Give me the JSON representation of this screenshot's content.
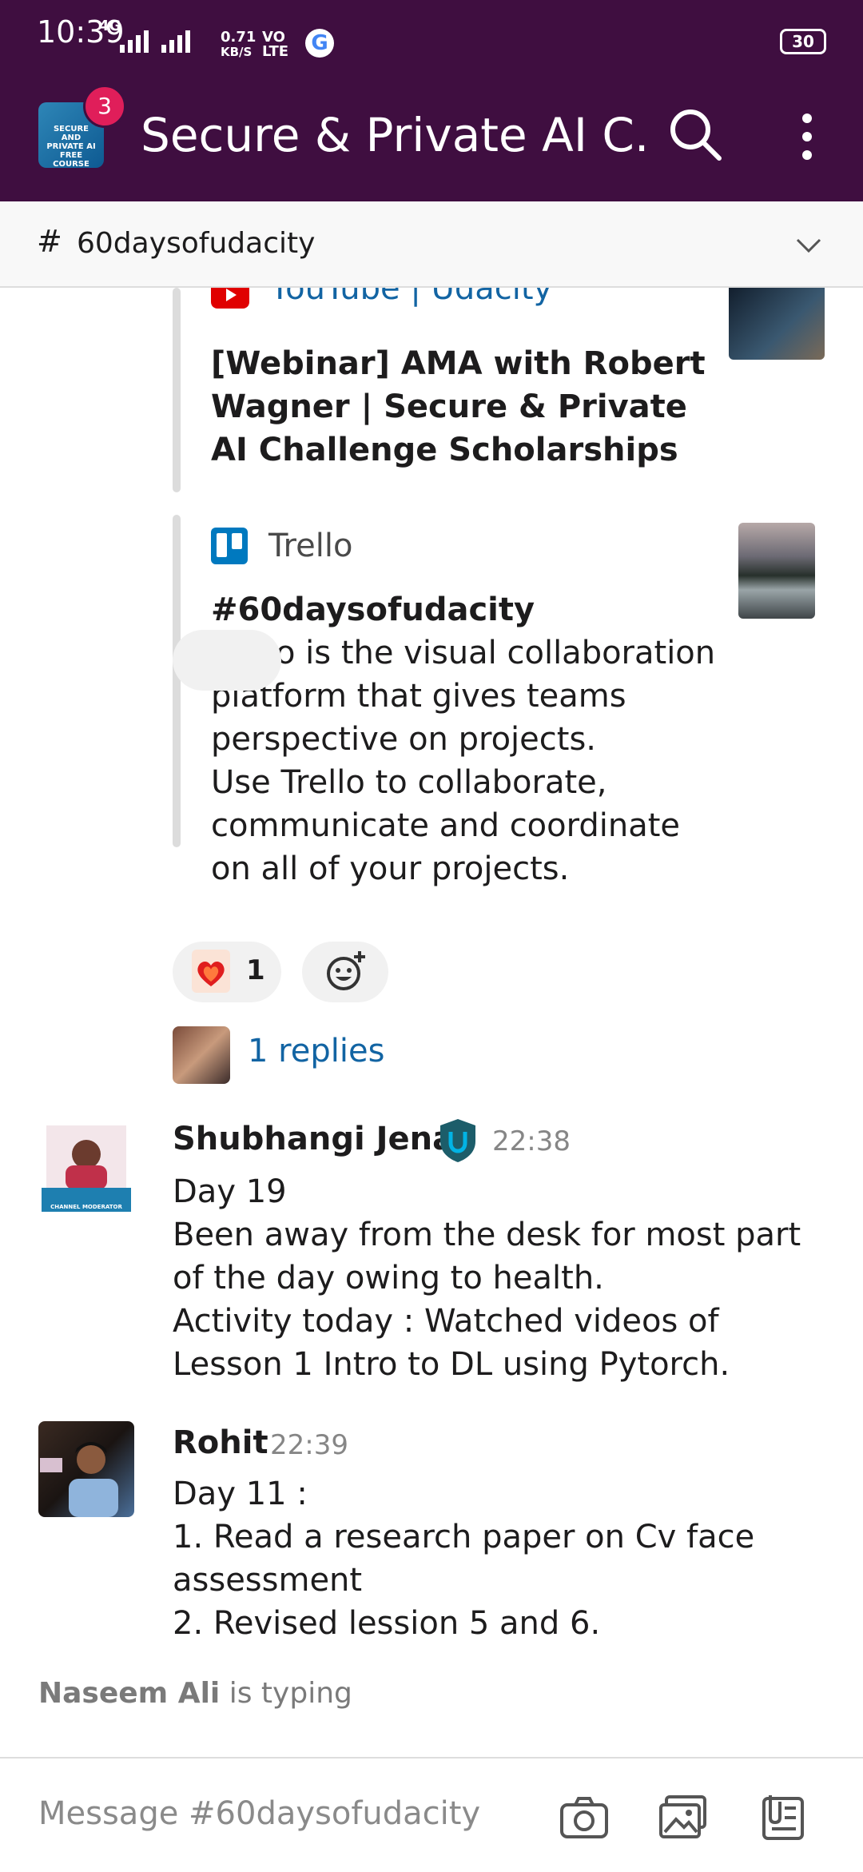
{
  "status_bar": {
    "time": "10:39",
    "network": "4G",
    "speed_value": "0.71",
    "speed_unit": "KB/S",
    "volte_top": "VO",
    "volte_bottom": "LTE",
    "battery": "30"
  },
  "header": {
    "workspace_badge": "3",
    "workspace_icon_text": "SECURE AND PRIVATE AI FREE COURSE",
    "title": "Secure & Private AI C...",
    "search_icon": "search-icon",
    "menu_icon": "kebab-menu-icon"
  },
  "channel": {
    "hash": "#",
    "name": "60daysofudacity"
  },
  "attachments": [
    {
      "service": "YouTube | Udacity",
      "title": "[Webinar] AMA with Robert Wagner | Secure & Private AI Challenge Scholarships"
    },
    {
      "service": "Trello",
      "title": "#60daysofudacity",
      "description": "Trello is the visual collaboration\nplatform that gives teams\nperspective on projects.\nUse Trello to collaborate,\ncommunicate and coordinate\non all of your projects."
    }
  ],
  "reactions": [
    {
      "emoji": "hot-heart-emoji",
      "count": "1"
    }
  ],
  "thread": {
    "replies_label": "1 replies"
  },
  "messages": [
    {
      "author": "Shubhangi Jena",
      "time": "22:38",
      "avatar_caption": "CHANNEL MODERATOR",
      "body": "Day 19\nBeen away from the desk for most part\nof the day owing to health.\nActivity today : Watched videos of\nLesson 1 Intro to DL using Pytorch."
    },
    {
      "author": "Rohit",
      "time": "22:39",
      "body": "Day 11 :\n1. Read a research paper on Cv face\nassessment\n2. Revised lession 5 and 6."
    }
  ],
  "typing": {
    "user": "Naseem Ali",
    "text": " is typing"
  },
  "composer": {
    "placeholder": "Message #60daysofudacity",
    "icons": [
      "camera-icon",
      "gallery-icon",
      "files-icon"
    ]
  },
  "colors": {
    "aubergine": "#3f0e40",
    "link_blue": "#1264a3",
    "badge_red": "#e01e5a"
  }
}
